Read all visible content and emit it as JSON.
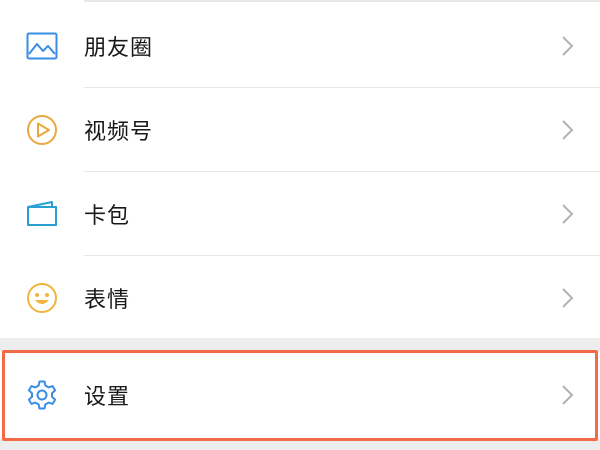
{
  "menu": {
    "items": [
      {
        "label": "朋友圈",
        "icon": "moments-image-icon"
      },
      {
        "label": "视频号",
        "icon": "channels-play-icon"
      },
      {
        "label": "卡包",
        "icon": "card-wallet-icon"
      },
      {
        "label": "表情",
        "icon": "sticker-smile-icon"
      }
    ],
    "settings": {
      "label": "设置",
      "icon": "gear-icon"
    }
  },
  "colors": {
    "moments": "#3a8ee6",
    "channels": "#e9a93c",
    "cards": "#2a9fd6",
    "stickers": "#f0b53a",
    "settings": "#3a8ee6",
    "highlight": "#f26b44",
    "chevron": "#b2b2b2"
  }
}
